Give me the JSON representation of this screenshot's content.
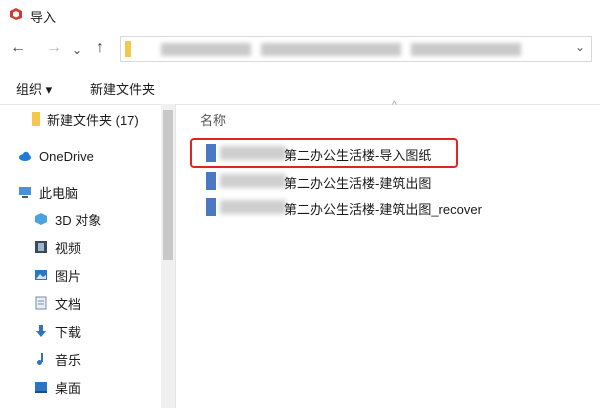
{
  "window": {
    "title": "导入"
  },
  "toolbar": {
    "organize": "组织 ▾",
    "new_folder": "新建文件夹"
  },
  "nav": {
    "items": [
      {
        "label": "新建文件夹 (17)",
        "icon": "folder-icon"
      },
      {
        "label": "OneDrive",
        "icon": "cloud-icon"
      },
      {
        "label": "此电脑",
        "icon": "computer-icon"
      },
      {
        "label": "3D 对象",
        "icon": "3d-objects-icon"
      },
      {
        "label": "视频",
        "icon": "video-icon"
      },
      {
        "label": "图片",
        "icon": "pictures-icon"
      },
      {
        "label": "文档",
        "icon": "documents-icon"
      },
      {
        "label": "下载",
        "icon": "download-icon"
      },
      {
        "label": "音乐",
        "icon": "music-icon"
      },
      {
        "label": "桌面",
        "icon": "desktop-icon"
      }
    ]
  },
  "files": {
    "column_name": "名称",
    "rows": [
      {
        "name": "第二办公生活楼-导入图纸"
      },
      {
        "name": "第二办公生活楼-建筑出图"
      },
      {
        "name": "第二办公生活楼-建筑出图_recover"
      }
    ]
  }
}
